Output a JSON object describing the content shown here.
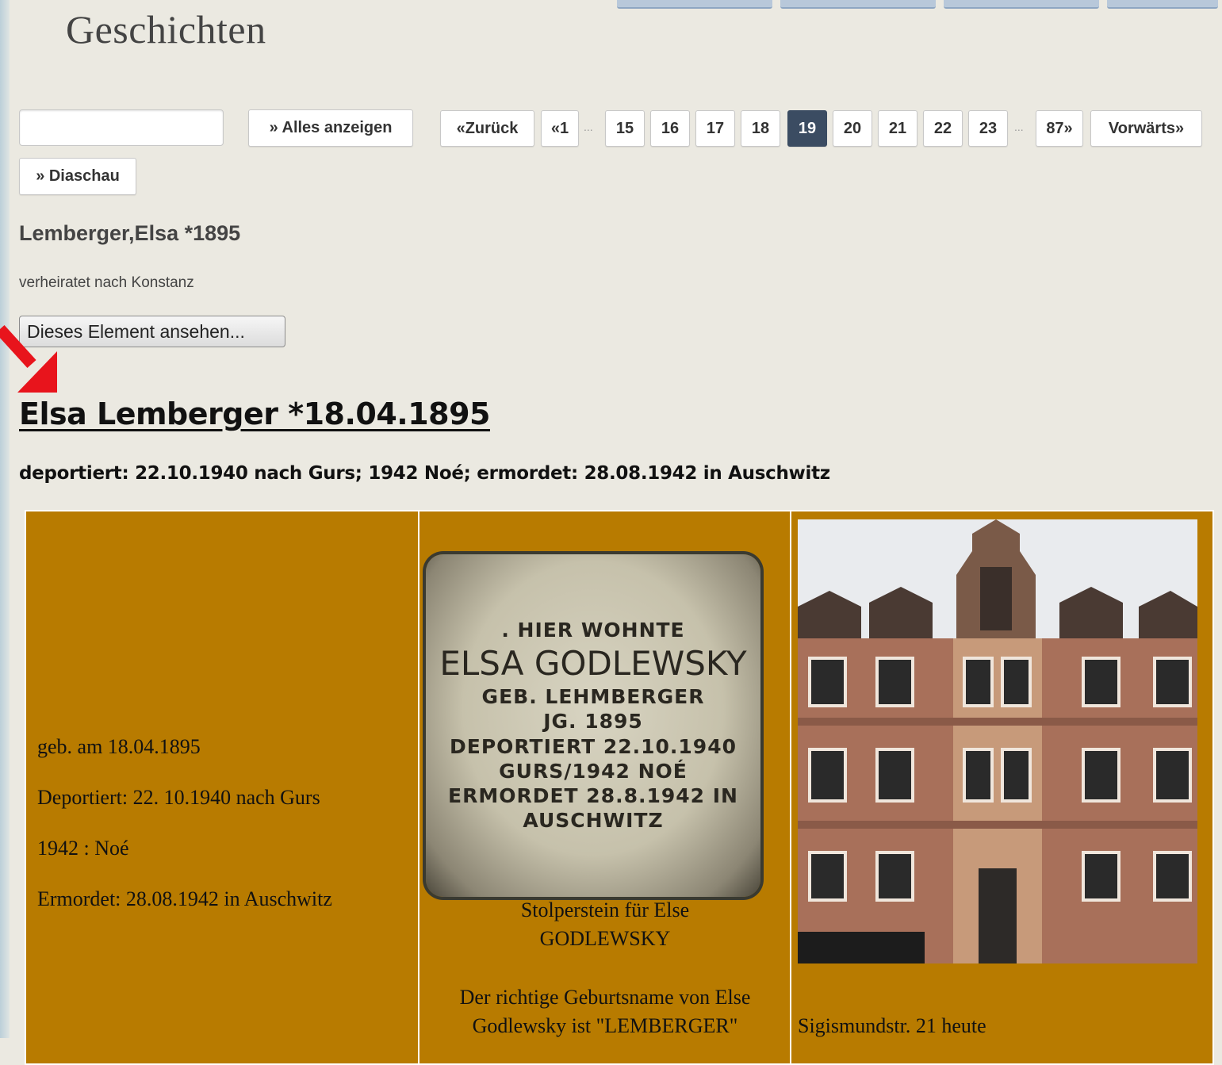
{
  "site": {
    "title": "Geschichten"
  },
  "controls": {
    "search_value": "",
    "show_all": "» Alles anzeigen",
    "slideshow": "» Diaschau"
  },
  "pagination": {
    "prev": "«Zurück",
    "first": "«1",
    "pages": [
      "15",
      "16",
      "17",
      "18",
      "19",
      "20",
      "21",
      "22",
      "23"
    ],
    "current": "19",
    "last": "87»",
    "next": "Vorwärts»",
    "ellipsis": "..."
  },
  "item": {
    "title": "Lemberger,Elsa *1895",
    "description": "verheiratet nach Konstanz",
    "view_button": "Dieses Element ansehen..."
  },
  "person": {
    "heading": "Elsa Lemberger *18.04.1895",
    "summary": "deportiert: 22.10.1940 nach Gurs; 1942 Noé; ermordet: 28.08.1942 in Auschwitz",
    "bio": [
      "geb. am 18.04.1895",
      "Deportiert: 22. 10.1940 nach Gurs",
      "1942 : Noé",
      "Ermordet: 28.08.1942 in Auschwitz"
    ],
    "stone_lines": [
      ". HIER WOHNTE",
      "ELSA GODLEWSKY",
      "GEB. LEHMBERGER",
      "JG. 1895",
      "DEPORTIERT 22.10.1940",
      "GURS/1942 NOÉ",
      "ERMORDET 28.8.1942 IN",
      "AUSCHWITZ"
    ],
    "stone_caption": [
      "Stolperstein für Else",
      "GODLEWSKY"
    ],
    "birthname_note": [
      "Der richtige Geburtsname von Else",
      "Godlewsky ist \"LEMBERGER\""
    ],
    "building_caption": "Sigismundstr. 21 heute"
  },
  "colors": {
    "page_bg": "#ebe9e1",
    "table_bg": "#b87b00",
    "active_page": "#3b4c62",
    "arrow": "#e8141c"
  }
}
